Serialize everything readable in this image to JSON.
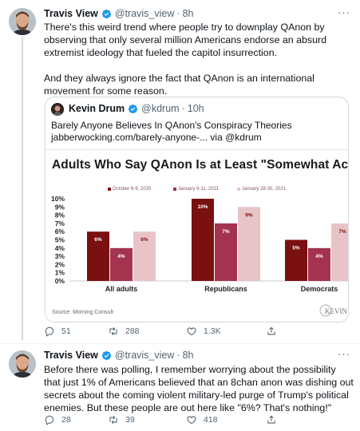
{
  "tweet1": {
    "name": "Travis View",
    "handle": "@travis_view",
    "time": "8h",
    "text": "There's this weird trend where people try to downplay QAnon by observing that only several million Americans endorse an absurd extremist ideology that fueled the capitol insurrection.\n\nAnd they always ignore the fact that QAnon is an international movement for some reason.",
    "replies": "51",
    "retweets": "288",
    "likes": "1.3K"
  },
  "quote": {
    "name": "Kevin Drum",
    "handle": "@kdrum",
    "time": "10h",
    "text_line1": "Barely Anyone Believes In QAnon's Conspiracy Theories",
    "text_line2": "jabberwocking.com/barely-anyone-... via @kdrum"
  },
  "chart_data": {
    "type": "bar",
    "title": "Adults Who Say QAnon Is at Least \"Somewhat Accur",
    "categories": [
      "All adults",
      "Republicans",
      "Democrats"
    ],
    "series": [
      {
        "name": "October 6-9, 2020",
        "values": [
          6,
          10,
          5
        ],
        "labels": [
          "6%",
          "10%",
          "5%"
        ],
        "color": "#7a1010"
      },
      {
        "name": "January 8-11, 2021",
        "values": [
          4,
          7,
          4
        ],
        "labels": [
          "4%",
          "7%",
          "4%"
        ],
        "color": "#a3334f"
      },
      {
        "name": "January 28-30, 2021",
        "values": [
          6,
          9,
          7
        ],
        "labels": [
          "6%",
          "9%",
          "7%"
        ],
        "color": "#e8c4c8"
      }
    ],
    "yticks": [
      "10%",
      "9%",
      "8%",
      "7%",
      "6%",
      "5%",
      "4%",
      "3%",
      "2%",
      "1%",
      "0%"
    ],
    "ylim": [
      0,
      10
    ],
    "source": "Source: Morning Consult",
    "watermark": "KEVIN"
  },
  "tweet2": {
    "name": "Travis View",
    "handle": "@travis_view",
    "time": "8h",
    "text": "Before there was polling, I remember worrying about the possibility that just 1% of Americans believed that an 8chan anon was dishing out secrets about the coming violent military-led purge of Trump's political enemies. But these people are out here like \"6%? That's nothing!\"",
    "replies": "28",
    "retweets": "39",
    "likes": "418"
  },
  "ui": {
    "dot": "·",
    "more": "···"
  },
  "colors": {
    "verified": "#1d9bf0",
    "secondary": "#536471",
    "border": "#cfd9de"
  },
  "icons": [
    "verified-badge-icon",
    "reply-icon",
    "retweet-icon",
    "like-icon",
    "share-icon",
    "more-icon"
  ]
}
